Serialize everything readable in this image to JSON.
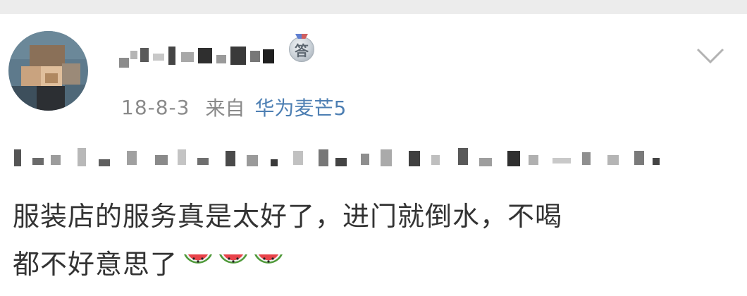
{
  "post": {
    "user": {
      "name_obscured": true,
      "badge": {
        "icon": "medal-icon",
        "label": "答"
      }
    },
    "date": "18-8-3",
    "from_label": "来自",
    "device": "华为麦芒5",
    "content": {
      "line_1": "服装店的服务真是太好了，进门就倒水，不喝",
      "line_2": "都不好意思了"
    },
    "emojis": [
      "watermelon-icon",
      "watermelon-icon",
      "watermelon-icon"
    ],
    "menu_icon": "chevron-down-icon"
  },
  "colors": {
    "meta_gray": "#8a8a8a",
    "link_blue": "#4d7fb3",
    "text": "#333333",
    "background": "#ffffff",
    "top_strip": "#ececec"
  }
}
